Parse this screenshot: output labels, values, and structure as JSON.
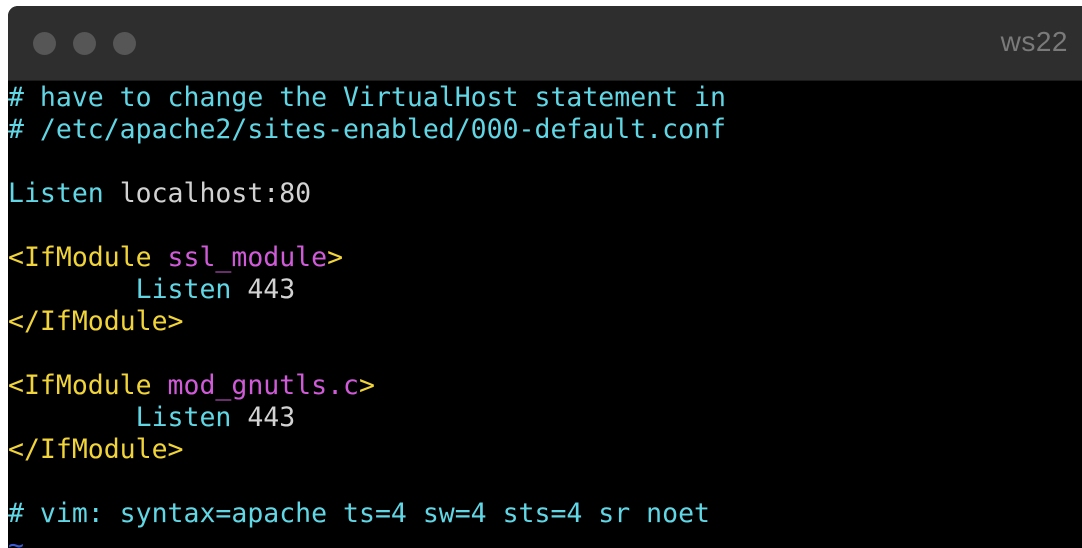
{
  "window": {
    "title": "ws22"
  },
  "colors": {
    "comment": "#61d6e5",
    "directive": "#61d6e5",
    "tag": "#f0d43a",
    "module": "#d05bd9",
    "value": "#d2d2d2",
    "tilde": "#3b5bd6"
  },
  "editor": {
    "lines": [
      [
        {
          "t": "# have to change the VirtualHost statement in",
          "c": "cyan"
        }
      ],
      [
        {
          "t": "# /etc/apache2/sites-enabled/000-default.conf",
          "c": "cyan"
        }
      ],
      [],
      [
        {
          "t": "Listen",
          "c": "cyan"
        },
        {
          "t": " localhost:80",
          "c": "white"
        }
      ],
      [],
      [
        {
          "t": "<IfModule",
          "c": "yellow"
        },
        {
          "t": " ssl_module",
          "c": "magenta"
        },
        {
          "t": ">",
          "c": "yellow"
        }
      ],
      [
        {
          "t": "        Listen",
          "c": "cyan"
        },
        {
          "t": " 443",
          "c": "white"
        }
      ],
      [
        {
          "t": "</IfModule>",
          "c": "yellow"
        }
      ],
      [],
      [
        {
          "t": "<IfModule",
          "c": "yellow"
        },
        {
          "t": " mod_gnutls.c",
          "c": "magenta"
        },
        {
          "t": ">",
          "c": "yellow"
        }
      ],
      [
        {
          "t": "        Listen",
          "c": "cyan"
        },
        {
          "t": " 443",
          "c": "white"
        }
      ],
      [
        {
          "t": "</IfModule>",
          "c": "yellow"
        }
      ],
      [],
      [
        {
          "t": "# vim: syntax=apache ts=4 sw=4 sts=4 sr noet",
          "c": "cyan"
        }
      ],
      [
        {
          "t": "~",
          "c": "blue"
        }
      ]
    ]
  }
}
